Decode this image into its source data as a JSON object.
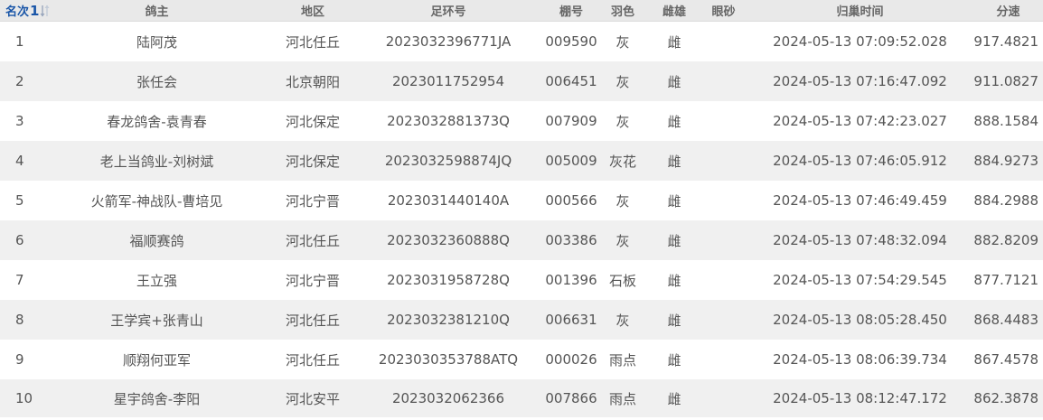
{
  "table": {
    "headers": {
      "rank": "名次",
      "sort_number": "1",
      "owner": "鸽主",
      "region": "地区",
      "ring": "足环号",
      "loft": "棚号",
      "color": "羽色",
      "sex": "雌雄",
      "eye": "眼砂",
      "time": "归巢时间",
      "speed": "分速"
    },
    "rows": [
      {
        "rank": "1",
        "owner": "陆阿茂",
        "region": "河北任丘",
        "ring": "2023032396771JA",
        "loft": "009590",
        "color": "灰",
        "sex": "雌",
        "eye": "",
        "time": "2024-05-13 07:09:52.028",
        "speed": "917.4821"
      },
      {
        "rank": "2",
        "owner": "张任会",
        "region": "北京朝阳",
        "ring": "2023011752954",
        "loft": "006451",
        "color": "灰",
        "sex": "雌",
        "eye": "",
        "time": "2024-05-13 07:16:47.092",
        "speed": "911.0827"
      },
      {
        "rank": "3",
        "owner": "春龙鸽舍-袁青春",
        "region": "河北保定",
        "ring": "2023032881373Q",
        "loft": "007909",
        "color": "灰",
        "sex": "雌",
        "eye": "",
        "time": "2024-05-13 07:42:23.027",
        "speed": "888.1584"
      },
      {
        "rank": "4",
        "owner": "老上当鸽业-刘树斌",
        "region": "河北保定",
        "ring": "2023032598874JQ",
        "loft": "005009",
        "color": "灰花",
        "sex": "雌",
        "eye": "",
        "time": "2024-05-13 07:46:05.912",
        "speed": "884.9273"
      },
      {
        "rank": "5",
        "owner": "火箭军-神战队-曹培见",
        "region": "河北宁晋",
        "ring": "2023031440140A",
        "loft": "000566",
        "color": "灰",
        "sex": "雌",
        "eye": "",
        "time": "2024-05-13 07:46:49.459",
        "speed": "884.2988"
      },
      {
        "rank": "6",
        "owner": "福顺赛鸽",
        "region": "河北任丘",
        "ring": "2023032360888Q",
        "loft": "003386",
        "color": "灰",
        "sex": "雌",
        "eye": "",
        "time": "2024-05-13 07:48:32.094",
        "speed": "882.8209"
      },
      {
        "rank": "7",
        "owner": "王立强",
        "region": "河北宁晋",
        "ring": "2023031958728Q",
        "loft": "001396",
        "color": "石板",
        "sex": "雌",
        "eye": "",
        "time": "2024-05-13 07:54:29.545",
        "speed": "877.7121"
      },
      {
        "rank": "8",
        "owner": "王学宾+张青山",
        "region": "河北任丘",
        "ring": "2023032381210Q",
        "loft": "006631",
        "color": "灰",
        "sex": "雌",
        "eye": "",
        "time": "2024-05-13 08:05:28.450",
        "speed": "868.4483"
      },
      {
        "rank": "9",
        "owner": "顺翔何亚军",
        "region": "河北任丘",
        "ring": "2023030353788ATQ",
        "loft": "000026",
        "color": "雨点",
        "sex": "雌",
        "eye": "",
        "time": "2024-05-13 08:06:39.734",
        "speed": "867.4578"
      },
      {
        "rank": "10",
        "owner": "星宇鸽舍-李阳",
        "region": "河北安平",
        "ring": "2023032062366",
        "loft": "007866",
        "color": "雨点",
        "sex": "雌",
        "eye": "",
        "time": "2024-05-13 08:12:47.172",
        "speed": "862.3878"
      }
    ]
  },
  "sort_icon": "sort-arrows-icon",
  "colors": {
    "header_bg": "#e9e9e9",
    "stripe_bg": "#f0f0f0",
    "accent": "#1a56a8",
    "text": "#555555"
  }
}
